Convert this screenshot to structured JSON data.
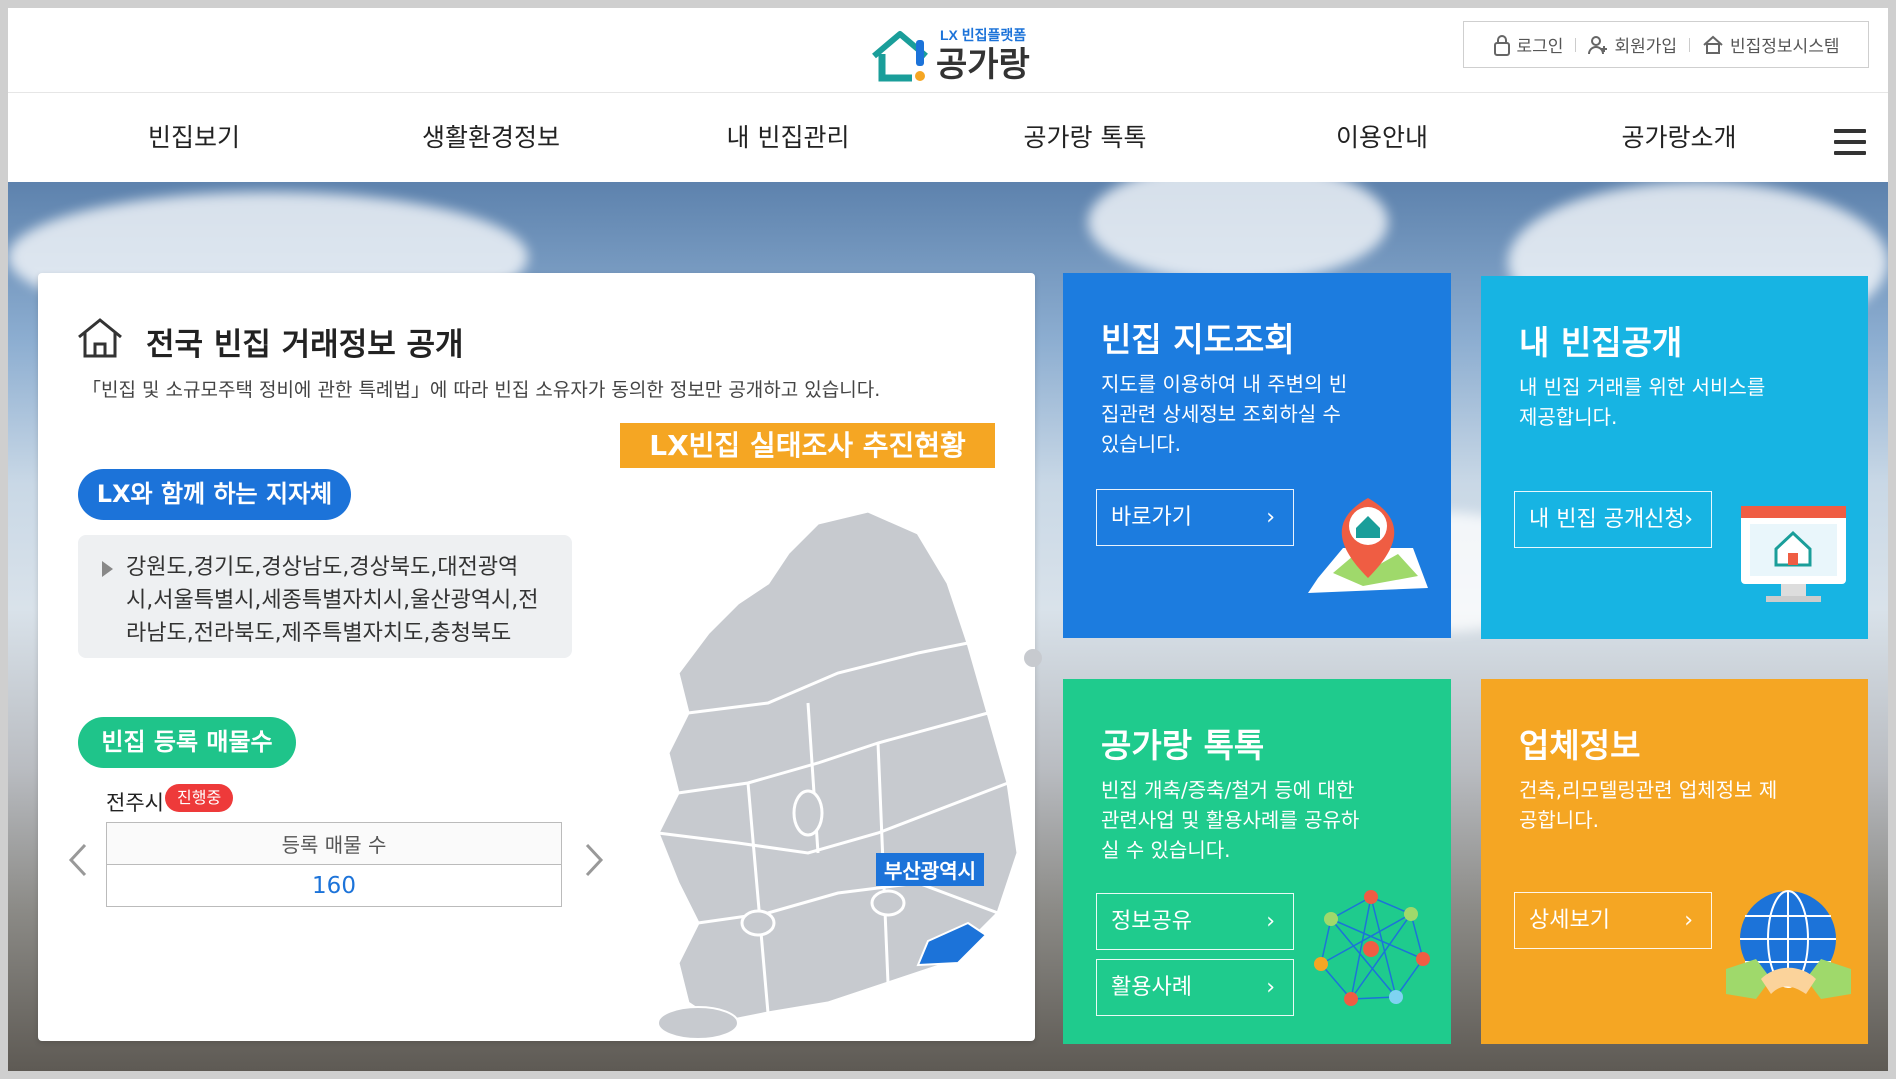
{
  "header": {
    "logo_small": "LX 빈집플랫폼",
    "logo_main": "공가랑",
    "util": [
      {
        "label": "로그인",
        "icon": "lock-icon"
      },
      {
        "label": "회원가입",
        "icon": "user-add-icon"
      },
      {
        "label": "빈집정보시스템",
        "icon": "home-icon"
      }
    ]
  },
  "nav": {
    "items": [
      "빈집보기",
      "생활환경정보",
      "내 빈집관리",
      "공가랑 톡톡",
      "이용안내",
      "공가랑소개"
    ],
    "menu_icon": "hamburger-icon"
  },
  "main": {
    "title": "전국 빈집 거래정보 공개",
    "desc": "「빈집 및 소규모주택 정비에 관한 특례법」에 따라 빈집 소유자가 동의한 정보만 공개하고 있습니다.",
    "lx_banner": "LX빈집 실태조사 추진현황",
    "local_pill": "LX와 함께 하는 지자체",
    "local_list": "강원도,경기도,경상남도,경상북도,대전광역시,서울특별시,세종특별자치시,울산광역시,전라남도,전라북도,제주특별자치도,충청북도",
    "reg_pill": "빈집 등록 매물수",
    "city": "전주시",
    "city_status": "진행중",
    "reg_header": "등록 매물 수",
    "reg_value": "160",
    "map_label": "부산광역시",
    "colors": {
      "blue": "#1c73d9",
      "green": "#1fc48a",
      "orange": "#f5a623",
      "red": "#ee3a3a"
    }
  },
  "cards": [
    {
      "title": "빈집 지도조회",
      "desc": "지도를 이용하여 내 주변의 빈집관련 상세정보 조회하실 수 있습니다.",
      "buttons": [
        "바로가기"
      ],
      "color": "#1c7cdf"
    },
    {
      "title": "내 빈집공개",
      "desc": "내 빈집 거래를 위한 서비스를 제공합니다.",
      "buttons": [
        "내 빈집 공개신청"
      ],
      "color": "#17b4e3"
    },
    {
      "title": "공가랑 톡톡",
      "desc": "빈집 개축/증축/철거 등에 대한 관련사업 및 활용사례를 공유하실 수 있습니다.",
      "buttons": [
        "정보공유",
        "활용사례"
      ],
      "color": "#1fcb8d"
    },
    {
      "title": "업체정보",
      "desc": "건축,리모델링관련 업체정보 제공합니다.",
      "buttons": [
        "상세보기"
      ],
      "color": "#f5a623"
    }
  ]
}
